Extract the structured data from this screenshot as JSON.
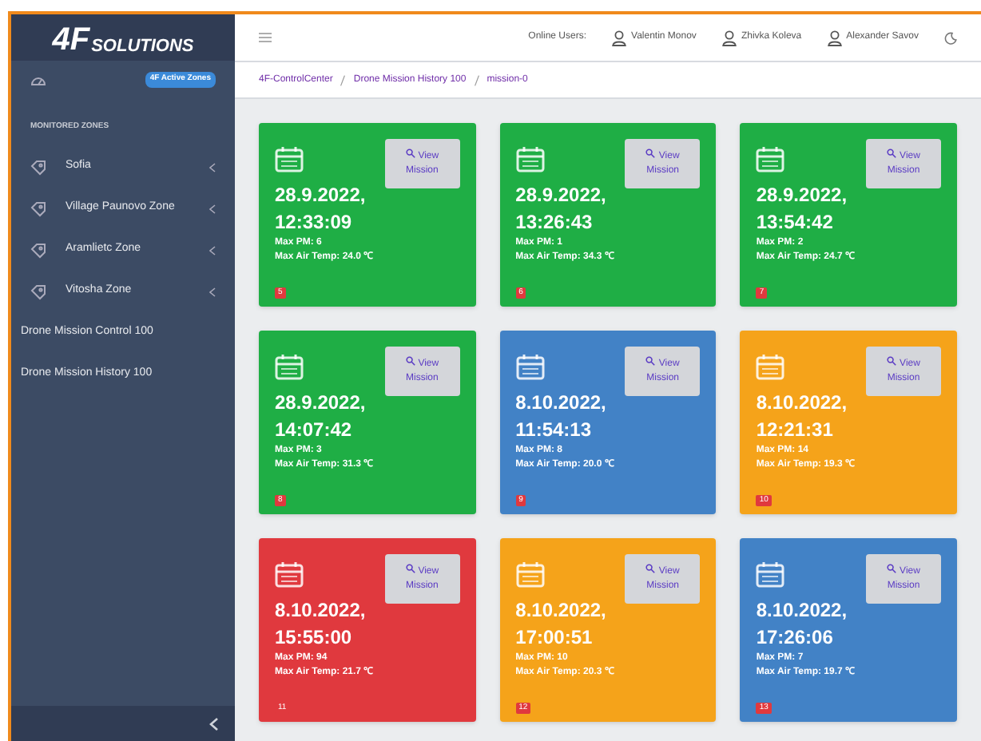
{
  "brand": {
    "big": "4F",
    "small": "SOLUTIONS"
  },
  "active_zones_badge": "4F Active Zones",
  "sidebar": {
    "section_title": "MONITORED ZONES",
    "items": [
      {
        "label": "Sofia",
        "kind": "zone"
      },
      {
        "label": "Village Paunovo Zone",
        "kind": "zone"
      },
      {
        "label": "Aramlietc Zone",
        "kind": "zone"
      },
      {
        "label": "Vitosha Zone",
        "kind": "zone"
      },
      {
        "label": "Drone Mission Control 100",
        "kind": "link"
      },
      {
        "label": "Drone Mission History 100",
        "kind": "link"
      }
    ]
  },
  "topbar": {
    "online_label": "Online Users:",
    "users": [
      "Valentin Monov",
      "Zhivka Koleva",
      "Alexander Savov"
    ]
  },
  "breadcrumb": [
    "4F-ControlCenter",
    "Drone Mission History 100",
    "mission-0"
  ],
  "missions": [
    {
      "date": "28.9.2022,",
      "time": "12:33:09",
      "max_pm": "Max PM: 6",
      "max_temp": "Max Air Temp: 24.0 ℃",
      "badge": "5",
      "color": "#1fae45",
      "button": "View Mission"
    },
    {
      "date": "28.9.2022,",
      "time": "13:26:43",
      "max_pm": "Max PM: 1",
      "max_temp": "Max Air Temp: 34.3 ℃",
      "badge": "6",
      "color": "#1fae45",
      "button": "View Mission"
    },
    {
      "date": "28.9.2022,",
      "time": "13:54:42",
      "max_pm": "Max PM: 2",
      "max_temp": "Max Air Temp: 24.7 ℃",
      "badge": "7",
      "color": "#1fae45",
      "button": "View Mission"
    },
    {
      "date": "28.9.2022,",
      "time": "14:07:42",
      "max_pm": "Max PM: 3",
      "max_temp": "Max Air Temp: 31.3 ℃",
      "badge": "8",
      "color": "#1fae45",
      "button": "View Mission"
    },
    {
      "date": "8.10.2022,",
      "time": "11:54:13",
      "max_pm": "Max PM: 8",
      "max_temp": "Max Air Temp: 20.0 ℃",
      "badge": "9",
      "color": "#4282c6",
      "button": "View Mission"
    },
    {
      "date": "8.10.2022,",
      "time": "12:21:31",
      "max_pm": "Max PM: 14",
      "max_temp": "Max Air Temp: 19.3 ℃",
      "badge": "10",
      "color": "#f5a31a",
      "button": "View Mission"
    },
    {
      "date": "8.10.2022,",
      "time": "15:55:00",
      "max_pm": "Max PM: 94",
      "max_temp": "Max Air Temp: 21.7 ℃",
      "badge": "11",
      "color": "#e0393e",
      "button": "View Mission"
    },
    {
      "date": "8.10.2022,",
      "time": "17:00:51",
      "max_pm": "Max PM: 10",
      "max_temp": "Max Air Temp: 20.3 ℃",
      "badge": "12",
      "color": "#f5a31a",
      "button": "View Mission"
    },
    {
      "date": "8.10.2022,",
      "time": "17:26:06",
      "max_pm": "Max PM: 7",
      "max_temp": "Max Air Temp: 19.7 ℃",
      "badge": "13",
      "color": "#4282c6",
      "button": "View Mission"
    }
  ]
}
